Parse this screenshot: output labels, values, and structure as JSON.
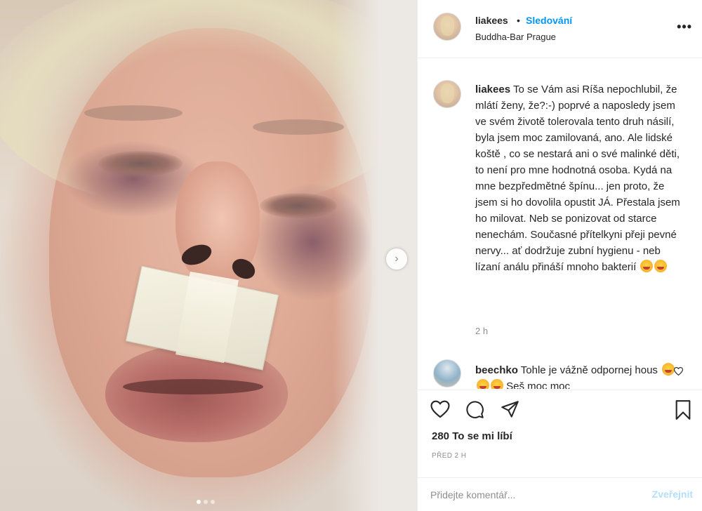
{
  "post": {
    "carousel_next_icon": "chevron-right-icon",
    "carousel_count": 3,
    "carousel_active": 0
  },
  "header": {
    "username": "liakees",
    "separator": "•",
    "follow_label": "Sledování",
    "location": "Buddha-Bar Prague",
    "more_icon": "•••"
  },
  "caption": {
    "username": "liakees",
    "text": "To se Vám asi Ríša nepochlubil, že mlátí ženy, že?:-) poprvé a naposledy jsem ve svém životě tolerovala tento druh násilí, byla jsem moc zamilovaná, ano. Ale lidské koště , co se nestará ani o své malinké děti, to není pro mne hodnotná osoba. Kydá na mne bezpředmětné špínu... jen proto, že jsem si ho dovolila opustit JÁ. Přestala jsem ho milovat. Neb se ponizovat od starce nenechám. Současné přítelkyni přeji pevné nervy... ať dodržuje zubní hygienu - neb lízaní análu přináší mnoho bakterií",
    "time": "2 h"
  },
  "reply": {
    "username": "beechko",
    "text": "Tohle je vážně odpornej hous",
    "text_tail": "Seš moc moc"
  },
  "actions": {
    "likes": "280 To se mi líbí",
    "ago": "PŘED 2 H"
  },
  "comment_box": {
    "placeholder": "Přidejte komentář...",
    "post_label": "Zveřejnit"
  },
  "colors": {
    "accent": "#0095f6",
    "post_disabled": "#b2dffc",
    "muted": "#8e8e8e",
    "text": "#262626"
  }
}
